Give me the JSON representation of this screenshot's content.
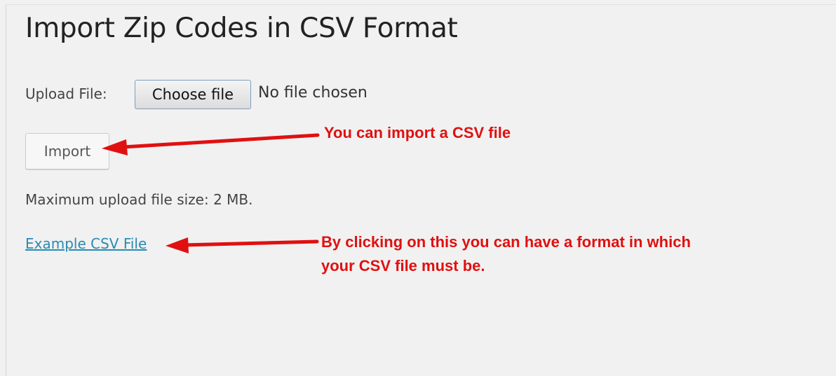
{
  "page": {
    "title": "Import Zip Codes in CSV Format"
  },
  "upload": {
    "label": "Upload File:",
    "choose_button": "Choose file",
    "status": "No file chosen"
  },
  "import": {
    "button_label": "Import"
  },
  "info": {
    "max_size": "Maximum upload file size: 2 MB."
  },
  "example": {
    "link_text": "Example CSV File"
  },
  "annotations": {
    "import_note": "You can import a CSV file",
    "example_note_line1": "By clicking on this you can have a format in which",
    "example_note_line2": "your CSV file must be.",
    "color": "#e01010"
  },
  "colors": {
    "link": "#2a8bb3",
    "background": "#f1f1f1"
  }
}
